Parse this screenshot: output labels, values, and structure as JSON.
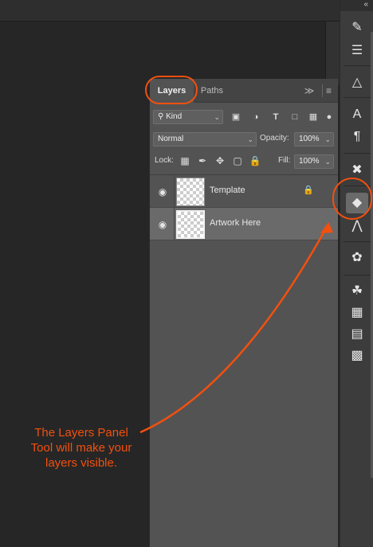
{
  "panel": {
    "tabs": [
      {
        "label": "Layers",
        "active": true
      },
      {
        "label": "Paths",
        "active": false
      }
    ],
    "collapse_icon": "double-chevron-right-icon",
    "menu_icon": "panel-menu-icon",
    "filter": {
      "kind_label": "Kind",
      "icons": [
        "image-filter-icon",
        "adjustment-filter-icon",
        "type-filter-icon",
        "shape-filter-icon",
        "smart-object-filter-icon"
      ]
    },
    "blend_mode": "Normal",
    "opacity_label": "Opacity:",
    "opacity_value": "100%",
    "lock_label": "Lock:",
    "fill_label": "Fill:",
    "fill_value": "100%",
    "layers": [
      {
        "name": "Template",
        "visible": true,
        "locked": true,
        "selected": false
      },
      {
        "name": "Artwork Here",
        "visible": true,
        "locked": false,
        "selected": true
      }
    ]
  },
  "toolbar": {
    "tools": [
      "brush-settings-icon",
      "brush-presets-icon",
      "history-icon",
      "character-icon",
      "paragraph-icon",
      "tools-cross-icon",
      "layers-icon",
      "paths-icon",
      "channels-icon",
      "swatches-icon",
      "grid-icon",
      "gradient-icon",
      "patterns-icon"
    ]
  },
  "annotation": {
    "callout_text": "The Layers Panel Tool will make your layers visible.",
    "color": "#f2500f"
  },
  "colors": {
    "accent": "#f2500f",
    "panel_bg": "#535353",
    "selected_layer_bg": "#6a6a6a",
    "canvas_bg": "#262626"
  }
}
